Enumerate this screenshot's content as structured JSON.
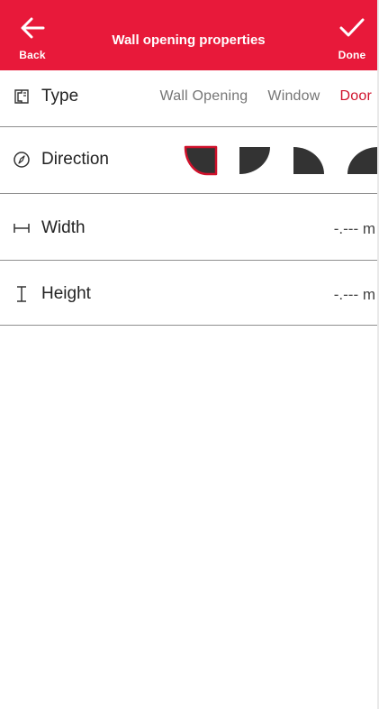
{
  "header": {
    "back_label": "Back",
    "title": "Wall opening properties",
    "done_label": "Done",
    "accent_color": "#e8193a"
  },
  "rows": {
    "type": {
      "label": "Type",
      "icon": "wall-opening-icon",
      "options": [
        "Wall Opening",
        "Window",
        "Door"
      ],
      "selected": "Door"
    },
    "direction": {
      "label": "Direction",
      "icon": "compass-icon",
      "options": [
        "door-direction-1-icon",
        "door-direction-2-icon",
        "door-direction-3-icon",
        "door-direction-4-icon"
      ],
      "selected_index": 0
    },
    "width": {
      "label": "Width",
      "icon": "width-icon",
      "value": "-.--- m"
    },
    "height": {
      "label": "Height",
      "icon": "height-icon",
      "value": "-.--- m"
    }
  }
}
